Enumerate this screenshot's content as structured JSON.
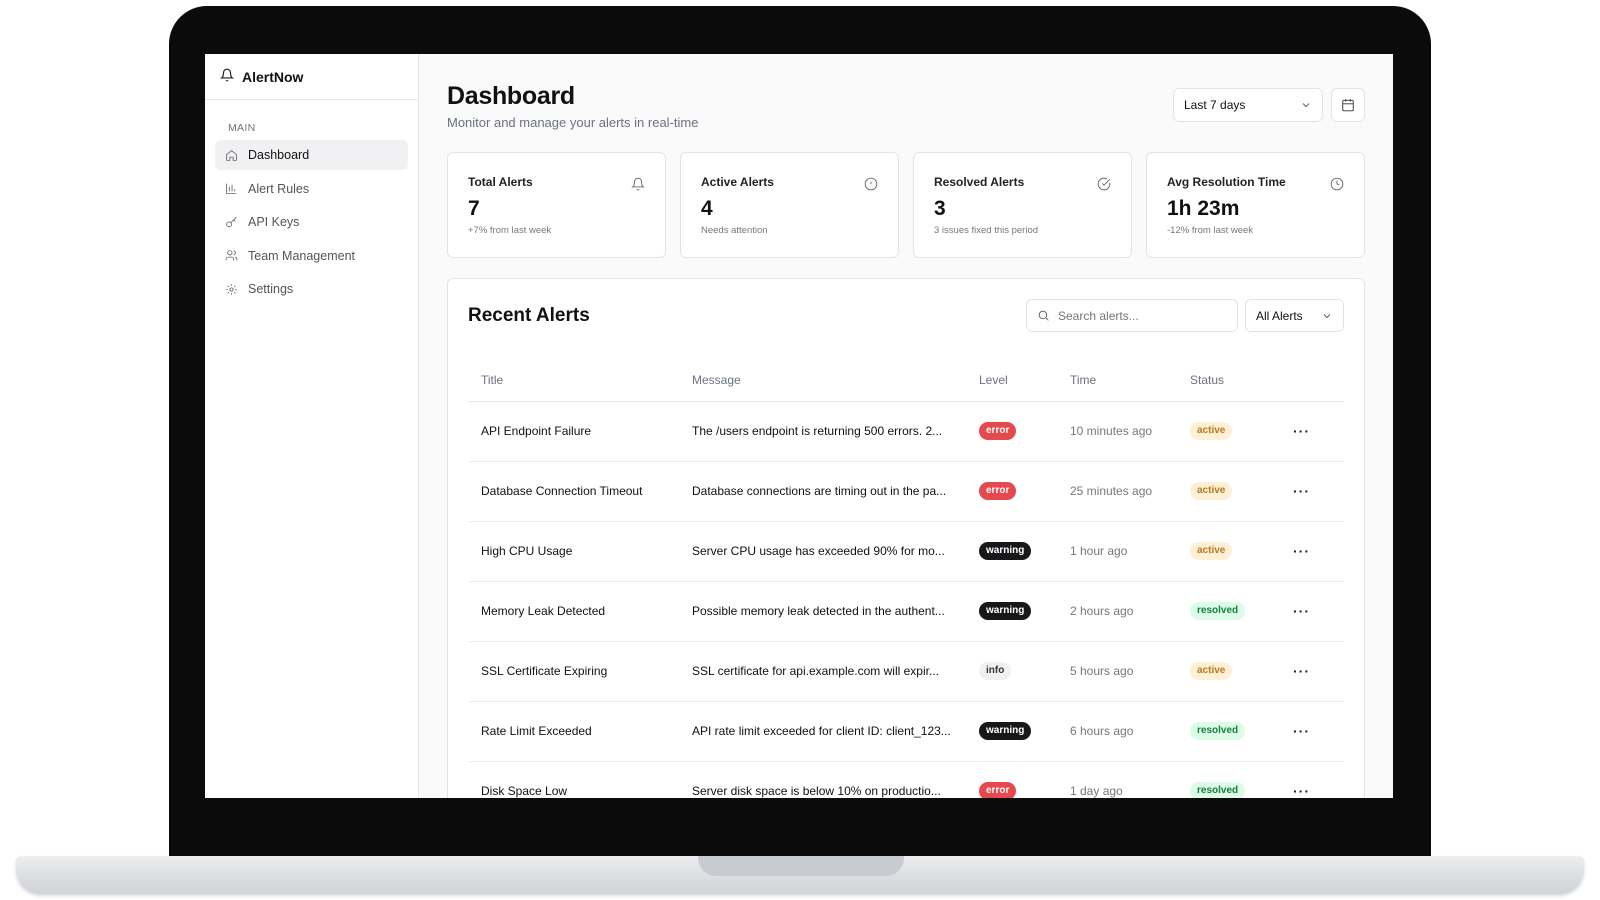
{
  "app": {
    "name": "AlertNow"
  },
  "sidebar": {
    "section": "MAIN",
    "items": [
      {
        "label": "Dashboard",
        "icon": "home-icon",
        "active": true
      },
      {
        "label": "Alert Rules",
        "icon": "bar-chart-icon",
        "active": false
      },
      {
        "label": "API Keys",
        "icon": "key-icon",
        "active": false
      },
      {
        "label": "Team Management",
        "icon": "users-icon",
        "active": false
      },
      {
        "label": "Settings",
        "icon": "gear-icon",
        "active": false
      }
    ]
  },
  "header": {
    "title": "Dashboard",
    "subtitle": "Monitor and manage your alerts in real-time",
    "range": "Last 7 days"
  },
  "stats": [
    {
      "label": "Total Alerts",
      "value": "7",
      "note": "+7% from last week",
      "icon": "bell-icon"
    },
    {
      "label": "Active Alerts",
      "value": "4",
      "note": "Needs attention",
      "icon": "alert-circle-icon"
    },
    {
      "label": "Resolved Alerts",
      "value": "3",
      "note": "3 issues fixed this period",
      "icon": "check-circle-icon"
    },
    {
      "label": "Avg Resolution Time",
      "value": "1h 23m",
      "note": "-12% from last week",
      "icon": "clock-icon"
    }
  ],
  "alerts": {
    "title": "Recent Alerts",
    "search_placeholder": "Search alerts...",
    "filter": "All Alerts",
    "columns": [
      "Title",
      "Message",
      "Level",
      "Time",
      "Status"
    ],
    "rows": [
      {
        "title": "API Endpoint Failure",
        "message": "The /users endpoint is returning 500 errors. 2...",
        "level": "error",
        "time": "10 minutes ago",
        "status": "active"
      },
      {
        "title": "Database Connection Timeout",
        "message": "Database connections are timing out in the pa...",
        "level": "error",
        "time": "25 minutes ago",
        "status": "active"
      },
      {
        "title": "High CPU Usage",
        "message": "Server CPU usage has exceeded 90% for mo...",
        "level": "warning",
        "time": "1 hour ago",
        "status": "active"
      },
      {
        "title": "Memory Leak Detected",
        "message": "Possible memory leak detected in the authent...",
        "level": "warning",
        "time": "2 hours ago",
        "status": "resolved"
      },
      {
        "title": "SSL Certificate Expiring",
        "message": "SSL certificate for api.example.com will expir...",
        "level": "info",
        "time": "5 hours ago",
        "status": "active"
      },
      {
        "title": "Rate Limit Exceeded",
        "message": "API rate limit exceeded for client ID: client_123...",
        "level": "warning",
        "time": "6 hours ago",
        "status": "resolved"
      },
      {
        "title": "Disk Space Low",
        "message": "Server disk space is below 10% on productio...",
        "level": "error",
        "time": "1 day ago",
        "status": "resolved"
      }
    ],
    "row_action": "···"
  }
}
